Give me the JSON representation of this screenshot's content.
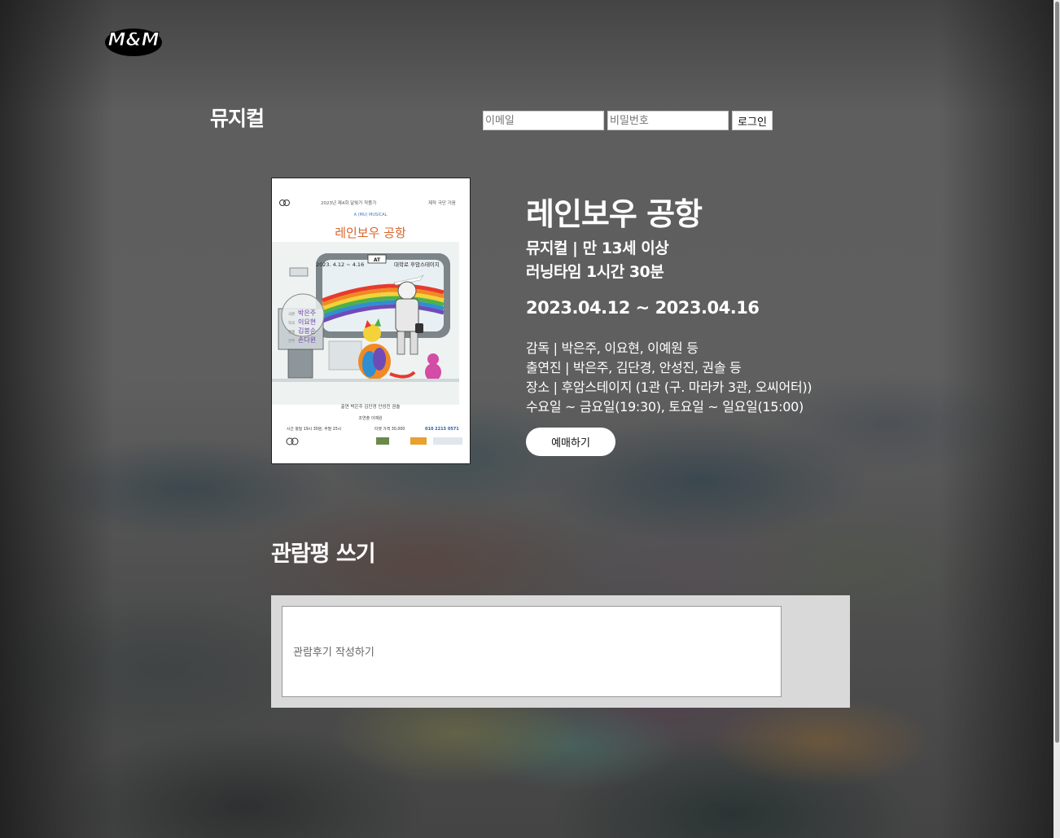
{
  "logo": {
    "text": "M&M"
  },
  "page_title": "뮤지컬",
  "login": {
    "email_placeholder": "이메일",
    "password_placeholder": "비밀번호",
    "login_label": "로그인"
  },
  "poster": {
    "producer": "제작 극단 거음",
    "festival": "2023년 제4회 달빛가 작품가",
    "subtitle": "A (MU) MUSICAL",
    "title": "레인보우 공항",
    "date_range": "2023. 4.12 ~ 4.16",
    "venue": "대학로 후암스테이지",
    "sign": "AT",
    "credits": [
      {
        "role": "극본",
        "name": "박은주"
      },
      {
        "role": "작곡",
        "name": "이요현"
      },
      {
        "role": "연출",
        "name": "김봉순"
      },
      {
        "role": "안무",
        "name": "손다윈"
      }
    ],
    "cast": "출연 박은주 김단경 안성진 권솔",
    "director": "조연출 이예원",
    "schedule": "시간 평일 19시 30분, 주말 15시",
    "price": "티켓 가격 30,000",
    "phone": "010 2215 0571"
  },
  "show": {
    "title": "레인보우 공항",
    "genre_age": "뮤지컬 | 만 13세 이상",
    "runtime": "러닝타임 1시간 30분",
    "dates": "2023.04.12 ~ 2023.04.16",
    "director": "감독 | 박은주, 이요현, 이예원 등",
    "cast": "출연진 | 박은주, 김단경, 안성진, 권솔 등",
    "venue": "장소 | 후암스테이지 (1관 (구. 마라카 3관, 오씨어터))",
    "schedule": "수요일 ~ 금요일(19:30), 토요일 ~ 일요일(15:00)",
    "book_label": "예매하기"
  },
  "review": {
    "heading": "관람평 쓰기",
    "placeholder": "관람후기 작성하기"
  },
  "colors": {
    "rainbow": [
      "#e63b2e",
      "#f08a24",
      "#f3d23a",
      "#4fb04a",
      "#2f8fd0",
      "#6f4bb8"
    ],
    "poster_title": "#d9652b"
  }
}
